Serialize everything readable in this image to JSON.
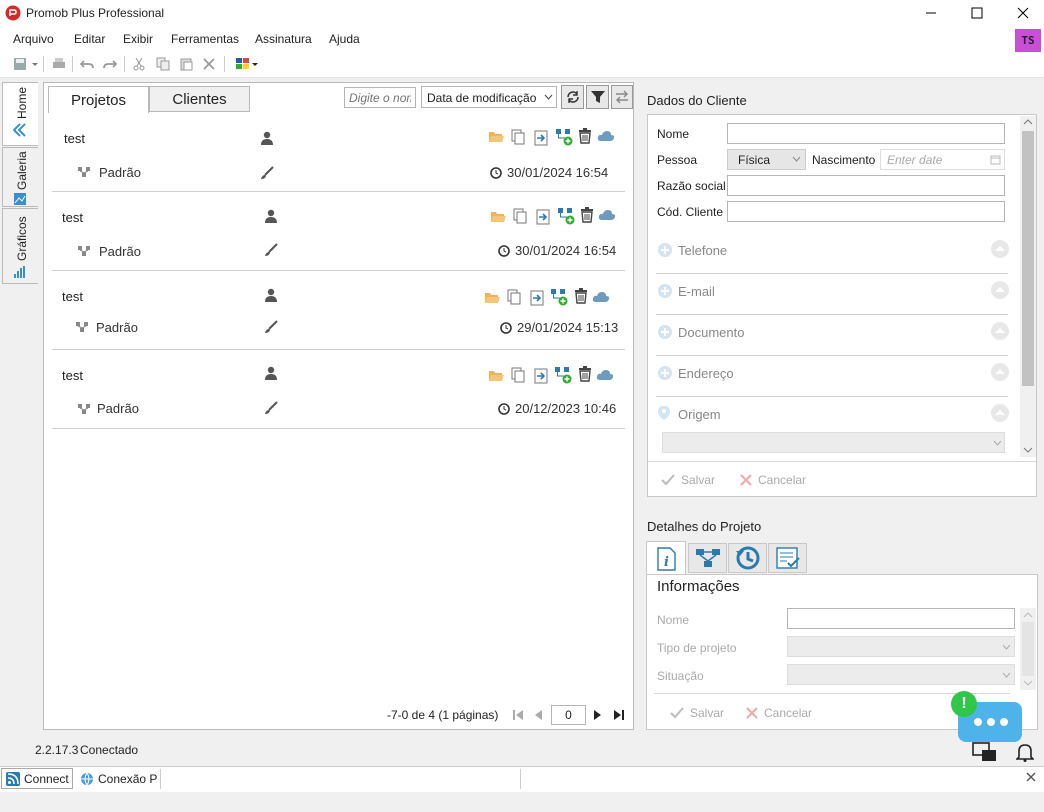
{
  "window": {
    "title": "Promob Plus Professional"
  },
  "menu": [
    "Arquivo",
    "Editar",
    "Exibir",
    "Ferramentas",
    "Assinatura",
    "Ajuda"
  ],
  "user": {
    "initials": "TS"
  },
  "sidebar": {
    "tabs": [
      {
        "label": "Home"
      },
      {
        "label": "Galeria"
      },
      {
        "label": "Gráficos"
      }
    ]
  },
  "projects": {
    "tabs": [
      "Projetos",
      "Clientes"
    ],
    "search_placeholder": "Digite o nom",
    "sort_selected": "Data de modificação",
    "items": [
      {
        "name": "test",
        "variant": "Padrão",
        "date": "30/01/2024 16:54"
      },
      {
        "name": "test",
        "variant": "Padrão",
        "date": "30/01/2024 16:54"
      },
      {
        "name": "test",
        "variant": "Padrão",
        "date": "29/01/2024 15:13"
      },
      {
        "name": "test",
        "variant": "Padrão",
        "date": "20/12/2023 10:46"
      }
    ],
    "pagination": {
      "summary": "-7-0 de 4 (1 páginas)",
      "page": "0"
    }
  },
  "client": {
    "title": "Dados do Cliente",
    "labels": {
      "nome": "Nome",
      "pessoa": "Pessoa",
      "nascimento": "Nascimento",
      "razao": "Razão social",
      "codigo": "Cód. Cliente"
    },
    "pessoa_value": "Física",
    "nascimento_placeholder": "Enter date",
    "sections": [
      "Telefone",
      "E-mail",
      "Documento",
      "Endereço",
      "Origem"
    ],
    "save": "Salvar",
    "cancel": "Cancelar"
  },
  "details": {
    "title": "Detalhes do Projeto",
    "heading": "Informações",
    "labels": {
      "nome": "Nome",
      "tipo": "Tipo de projeto",
      "situacao": "Situação"
    },
    "save": "Salvar",
    "cancel": "Cancelar"
  },
  "status": {
    "version": "2.2.17.3",
    "state": "Conectado"
  },
  "taskbar": {
    "connect": "Connect",
    "conexao": "Conexão P"
  },
  "colors": {
    "accent": "#c94fd6",
    "folder": "#f0b35a",
    "blue": "#2a7ab0",
    "cloud": "#6f9bbf"
  }
}
